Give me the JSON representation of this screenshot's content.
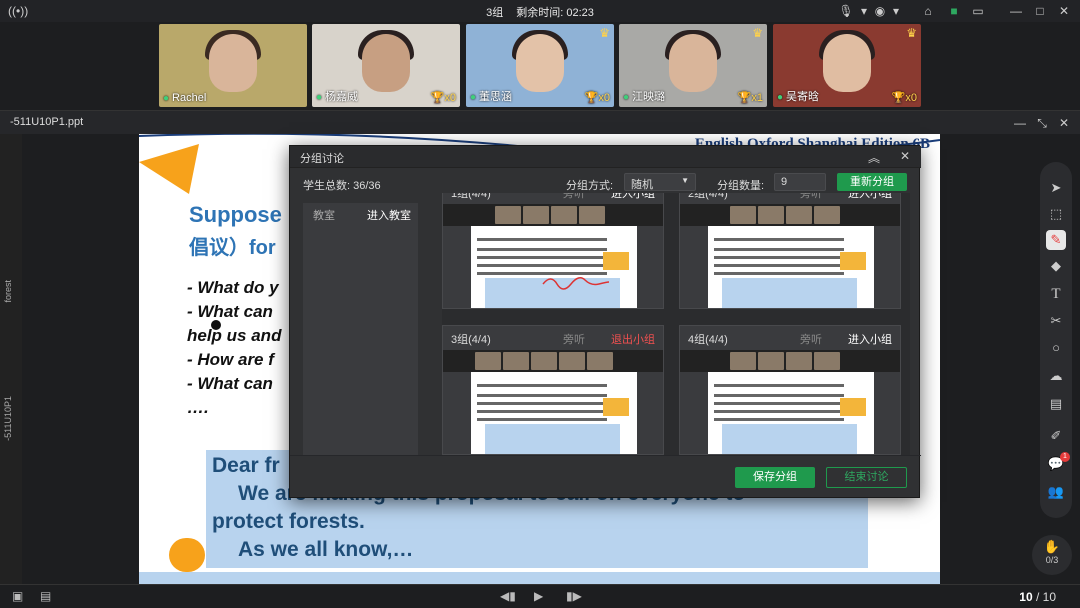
{
  "topbar": {
    "group_label": "3组",
    "time_label": "剩余时间: 02:23"
  },
  "participants": [
    {
      "name": "Rachel",
      "cup": "",
      "crown": false
    },
    {
      "name": "杨嘉威",
      "cup": "x0",
      "crown": false
    },
    {
      "name": "董思涵",
      "cup": "x0",
      "crown": true
    },
    {
      "name": "江映璐",
      "cup": "x1",
      "crown": true
    },
    {
      "name": "吴寄晗",
      "cup": "x0",
      "crown": true
    }
  ],
  "file": {
    "name": "-511U10P1.ppt"
  },
  "left_labels": {
    "forest": "forest",
    "deck": "-511U10P1"
  },
  "slide": {
    "brand": "English Oxford Shanghai Edition 6B",
    "heading1": "Suppose",
    "heading2": "倡议）for",
    "questions": [
      "- What do y",
      "- What can",
      "help us and",
      "- How are f",
      "- What can",
      "…."
    ],
    "dear_lines": [
      "Dear fr",
      "We are making this proposal to call on everyone to",
      "protect forests.",
      "As we all know,…"
    ]
  },
  "dialog": {
    "title": "分组讨论",
    "total_label": "学生总数: 36/36",
    "method_label": "分组方式:",
    "method_value": "随机",
    "count_label": "分组数量:",
    "count_value": "9",
    "regroup_button": "重新分组",
    "tab_classroom": "教室",
    "tab_enter_classroom": "进入教室",
    "save_button": "保存分组",
    "end_button": "结束讨论",
    "groups": [
      {
        "title": "1组(4/4)",
        "watch": "旁听",
        "join": "进入小组",
        "exit": false
      },
      {
        "title": "2组(4/4)",
        "watch": "旁听",
        "join": "进入小组",
        "exit": false
      },
      {
        "title": "3组(4/4)",
        "watch": "旁听",
        "join": "退出小组",
        "exit": true
      },
      {
        "title": "4组(4/4)",
        "watch": "旁听",
        "join": "进入小组",
        "exit": false
      }
    ]
  },
  "pager": {
    "current": "10",
    "total": "/ 10"
  },
  "hand": {
    "count": "0/3"
  },
  "notif_badge": "1",
  "colors": {
    "accent_green": "#1f9a4d",
    "exit_red": "#f05050",
    "slide_blue": "#2e74b5"
  }
}
